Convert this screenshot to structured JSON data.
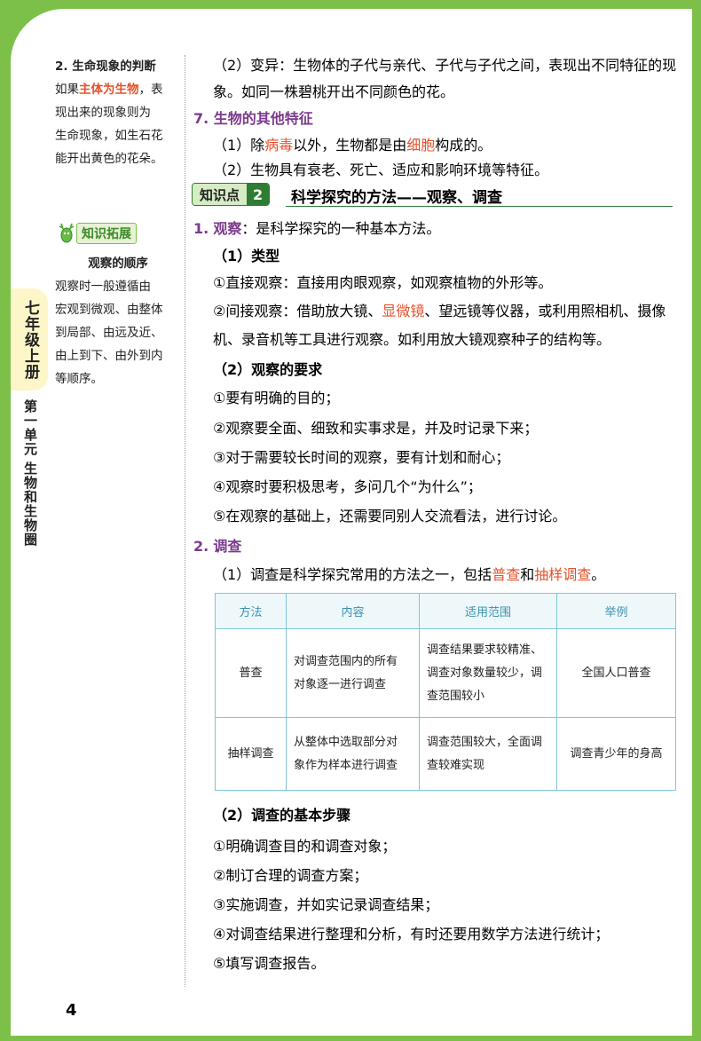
{
  "page_number": "4",
  "spine": {
    "grade": "七年级上册",
    "unit": "第一单元",
    "unit_title": "生物和生物圈"
  },
  "side_note_1": {
    "title": "2. 生命现象的判断",
    "line1_pre": "如果",
    "line1_red": "主体为生物",
    "line1_post": "，表",
    "line2": "现出来的现象则为",
    "line3": "生命现象，如生石花",
    "line4": "能开出黄色的花朵。"
  },
  "side_note_2": {
    "badge": "知识拓展",
    "title": "观察的顺序",
    "line1": "观察时一般遵循由",
    "line2": "宏观到微观、由整体",
    "line3": "到局部、由远及近、",
    "line4": "由上到下、由外到内",
    "line5": "等顺序。"
  },
  "main": {
    "var_l1": "（2）变异：生物体的子代与亲代、子代与子代之间，表现出不同特征的现",
    "var_l2": "象。如同一株碧桃开出不同颜色的花。",
    "h7": "7. 生物的其他特征",
    "p7_1_pre": "（1）除",
    "p7_1_red1": "病毒",
    "p7_1_mid": "以外，生物都是由",
    "p7_1_red2": "细胞",
    "p7_1_post": "构成的。",
    "p7_2": "（2）生物具有衰老、死亡、适应和影响环境等特征。",
    "section_label": "知识点",
    "section_num": "2",
    "section_title": "科学探究的方法——观察、调查",
    "h1_num": "1.",
    "h1_word": "观察",
    "h1_rest": "：是科学探究的一种基本方法。",
    "h_type": "（1）类型",
    "t1": "①直接观察：直接用肉眼观察，如观察植物的外形等。",
    "t2_pre": "②间接观察：借助放大镜、",
    "t2_red": "显微镜",
    "t2_post": "、望远镜等仪器，或利用照相机、摄像",
    "t3": "机、录音机等工具进行观察。如利用放大镜观察种子的结构等。",
    "h_req": "（2）观察的要求",
    "r1": "①要有明确的目的；",
    "r2": "②观察要全面、细致和实事求是，并及时记录下来；",
    "r3": "③对于需要较长时间的观察，要有计划和耐心；",
    "r4": "④观察时要积极思考，多问几个“为什么”；",
    "r5": "⑤在观察的基础上，还需要同别人交流看法，进行讨论。",
    "h2_num": "2.",
    "h2_word": "调查",
    "s1_pre": "（1）调查是科学探究常用的方法之一，包括",
    "s1_red1": "普查",
    "s1_mid": "和",
    "s1_red2": "抽样调查",
    "s1_post": "。",
    "h_steps": "（2）调查的基本步骤",
    "st1": "①明确调查目的和调查对象；",
    "st2": "②制订合理的调查方案；",
    "st3": "③实施调查，并如实记录调查结果；",
    "st4": "④对调查结果进行整理和分析，有时还要用数学方法进行统计；",
    "st5": "⑤填写调查报告。"
  },
  "table": {
    "headers": [
      "方法",
      "内容",
      "适用范围",
      "举例"
    ],
    "rows": [
      {
        "method": "普查",
        "content": [
          "对调查范围内的所有",
          "对象逐一进行调查"
        ],
        "scope": [
          "调查结果要求较精准、",
          "调查对象数量较少，调",
          "查范围较小"
        ],
        "example": "全国人口普查"
      },
      {
        "method": "抽样调查",
        "content": [
          "从整体中选取部分对",
          "象作为样本进行调查"
        ],
        "scope": [
          "调查范围较大，全面调",
          "查较难实现"
        ],
        "example": "调查青少年的身高"
      }
    ]
  },
  "colors": {
    "accent_green": "#7cc04a",
    "highlight_red": "#e6502a",
    "heading_purple": "#7b3a8c",
    "table_border": "#7fc6d6"
  }
}
